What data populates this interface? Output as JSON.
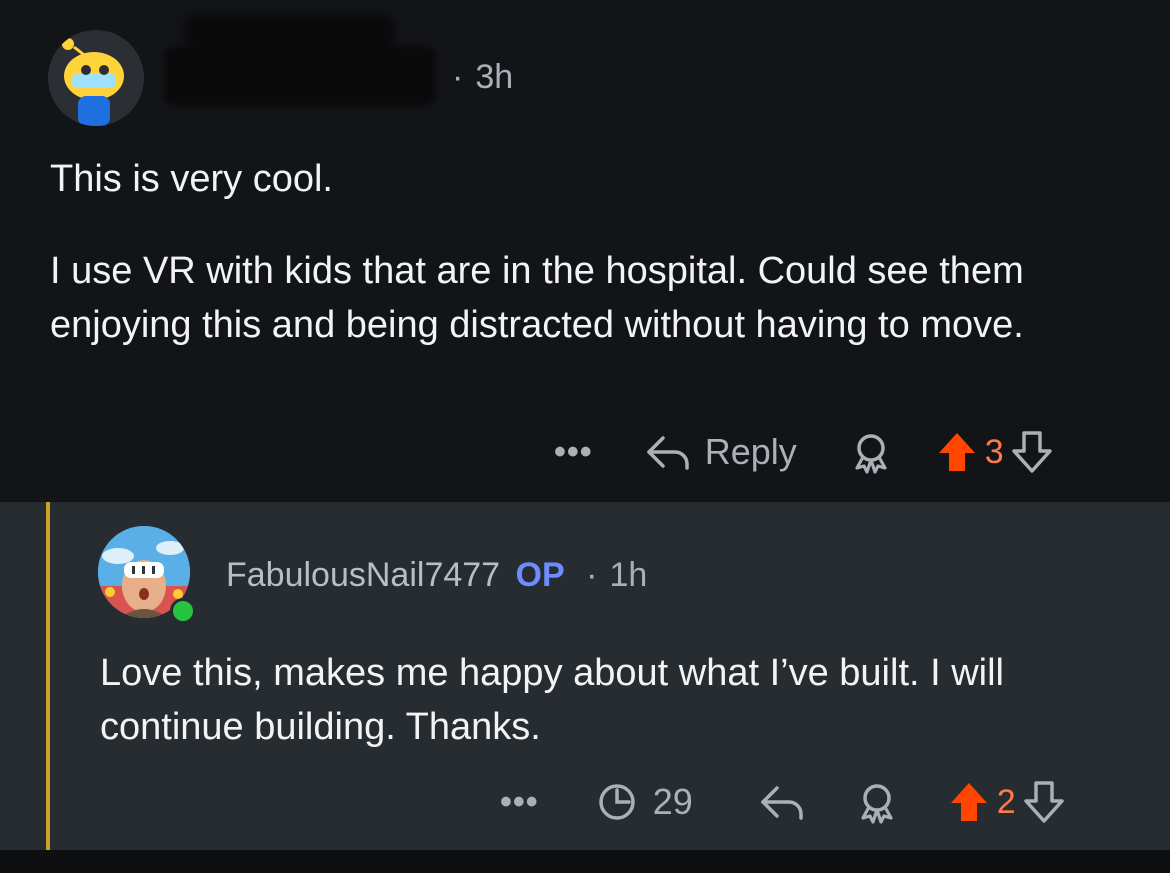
{
  "comments": [
    {
      "time": "3h",
      "paragraphs": [
        "This is very cool.",
        "I use VR with kids that are in the hospital. Could see them enjoying this and being distracted without having to move."
      ],
      "actions": {
        "more": "•••",
        "reply_label": "Reply",
        "score": "3"
      }
    },
    {
      "username": "FabulousNail7477",
      "op_label": "OP",
      "time": "1h",
      "body": "Love this, makes me happy about what I’ve built. I will continue building. Thanks.",
      "actions": {
        "more": "•••",
        "views": "29",
        "score": "2"
      }
    }
  ],
  "colors": {
    "upvote": "#ff4500",
    "op": "#6c8cff",
    "thread_line": "#c9a227",
    "online": "#27c43f"
  },
  "icons": [
    "snoo-avatar-icon",
    "user-avatar-icon",
    "more-icon",
    "reply-icon",
    "award-icon",
    "upvote-icon",
    "downvote-icon",
    "views-clock-icon"
  ]
}
